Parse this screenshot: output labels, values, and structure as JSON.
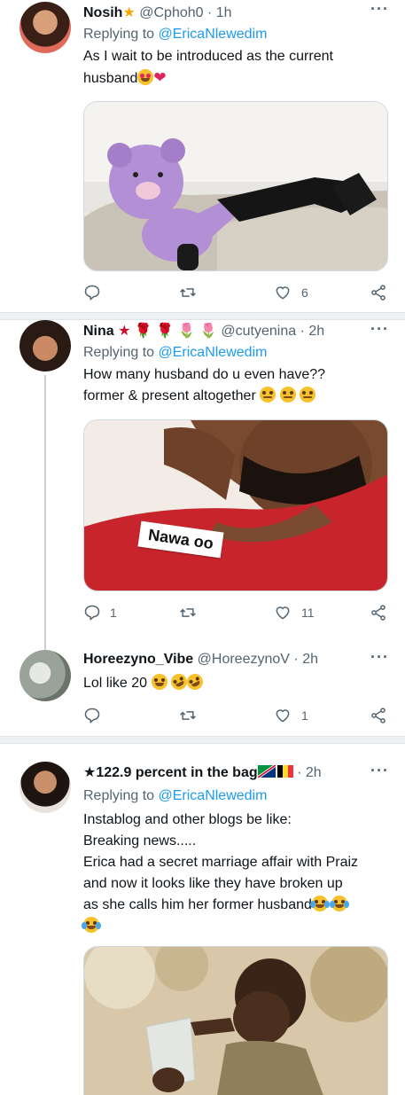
{
  "tweets": [
    {
      "name": "Nosih",
      "name_suffix": "★",
      "handle": "@Cphoh0",
      "time": "1h",
      "replying_prefix": "Replying to",
      "replying_to": "@EricaNlewedim",
      "text": "As I wait to be introduced as the current husband",
      "emojis": [
        "heart-eyes",
        "red-heart"
      ],
      "media_description_icon": "purple-teddy-bear-photo",
      "actions": {
        "replies": "",
        "retweets": "",
        "likes": "6"
      }
    },
    {
      "name": "Nina",
      "name_suffix": "★ 🌹 🌹 🌷 🌷",
      "handle": "@cutyenina",
      "time": "2h",
      "replying_prefix": "Replying to",
      "replying_to": "@EricaNlewedim",
      "text_lines": [
        "How many husband do u even have??",
        "former & present altogether"
      ],
      "emojis": [
        "eye-roll",
        "eye-roll",
        "eye-roll"
      ],
      "media_caption": "Nawa oo",
      "actions": {
        "replies": "1",
        "retweets": "",
        "likes": "11"
      }
    },
    {
      "name": "Horeezyno_Vibe",
      "handle": "@HoreezynoV",
      "time": "2h",
      "text": "Lol like 20",
      "emojis": [
        "grin",
        "rofl",
        "rofl"
      ],
      "actions": {
        "replies": "",
        "retweets": "",
        "likes": "1"
      }
    },
    {
      "name": "★122.9 percent in the bag",
      "name_suffix_flags": [
        "namibia-flag",
        "belgium-flag"
      ],
      "handle": "",
      "time": "2h",
      "replying_prefix": "Replying to",
      "replying_to": "@EricaNlewedim",
      "text_lines": [
        "Instablog and other blogs be like:",
        "Breaking news.....",
        "Erica had a secret marriage affair with Praiz",
        "and now it looks like they have broken up",
        "as she calls him her former husband"
      ],
      "emojis": [
        "joy",
        "joy",
        "joy"
      ],
      "media_description_icon": "boy-drinking-water-photo"
    }
  ],
  "ui": {
    "more_icon": "more-horizontal-icon",
    "dot": "·",
    "colors": {
      "link": "#1d9bf0",
      "muted": "#536471",
      "like": "#e0245e",
      "separator": "#eef1f3"
    }
  }
}
